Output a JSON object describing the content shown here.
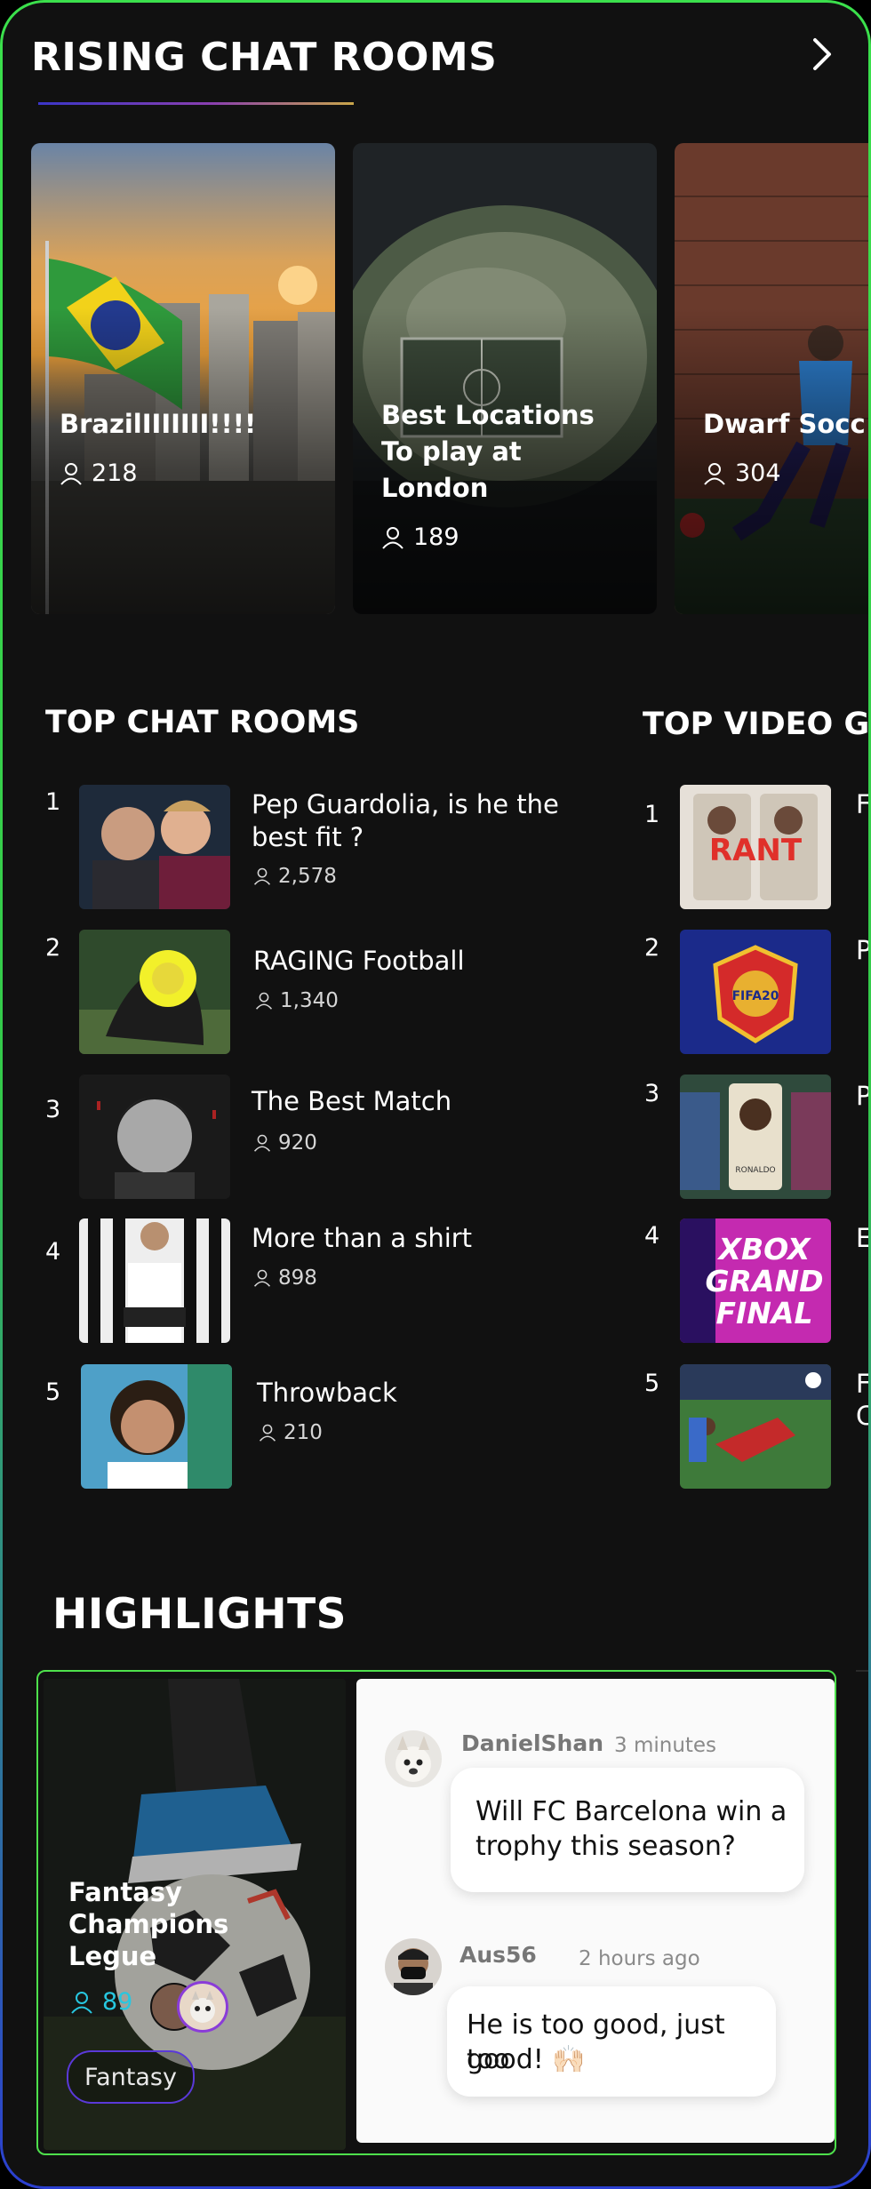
{
  "rising": {
    "title": "RISING CHAT ROOMS",
    "cards": [
      {
        "title": "BrazilIIIIIII!!!!",
        "count": "218"
      },
      {
        "title_lines": [
          "Best Locations",
          "To play at",
          "London"
        ],
        "count": "189"
      },
      {
        "title": "Dwarf Socc",
        "count": "304"
      }
    ]
  },
  "top_chat": {
    "title": "TOP CHAT ROOMS",
    "items": [
      {
        "rank": "1",
        "title_lines": [
          "Pep Guardolia, is he the",
          "best fit ?"
        ],
        "count": "2,578"
      },
      {
        "rank": "2",
        "title": "RAGING Football",
        "count": "1,340"
      },
      {
        "rank": "3",
        "title": "The Best Match",
        "count": "920"
      },
      {
        "rank": "4",
        "title": "More than a shirt",
        "count": "898"
      },
      {
        "rank": "5",
        "title": "Throwback",
        "count": "210"
      }
    ]
  },
  "top_video": {
    "title": "TOP VIDEO GA",
    "items": [
      {
        "rank": "1",
        "thumb_text": "RANT",
        "title": "F"
      },
      {
        "rank": "2",
        "thumb_text": "FIFA20",
        "title": "P"
      },
      {
        "rank": "3",
        "thumb_text": "RONALDO",
        "title": "P"
      },
      {
        "rank": "4",
        "thumb_lines": [
          "XBOX",
          "GRAND",
          "FINAL"
        ],
        "title": "E"
      },
      {
        "rank": "5",
        "title_lines": [
          "F",
          "C"
        ]
      }
    ]
  },
  "highlights": {
    "title": "HIGHLIGHTS",
    "card": {
      "title_lines": [
        "Fantasy",
        "Champions",
        "Legue"
      ],
      "count": "89",
      "tag": "Fantasy"
    },
    "comments": [
      {
        "user": "DanielShan",
        "time": "3 minutes",
        "text_lines": [
          "Will FC Barcelona win a",
          "trophy this season?"
        ]
      },
      {
        "user": "Aus56",
        "time": "2 hours ago",
        "text_lines": [
          "He is too good, just too",
          "good! 🙌🏻"
        ]
      }
    ]
  },
  "colors": {
    "accent_green": "#4ee04c",
    "accent_cyan": "#27c7e0",
    "tag_border": "#5a39d8"
  },
  "icons": [
    "chevron-right-icon",
    "person-icon"
  ]
}
